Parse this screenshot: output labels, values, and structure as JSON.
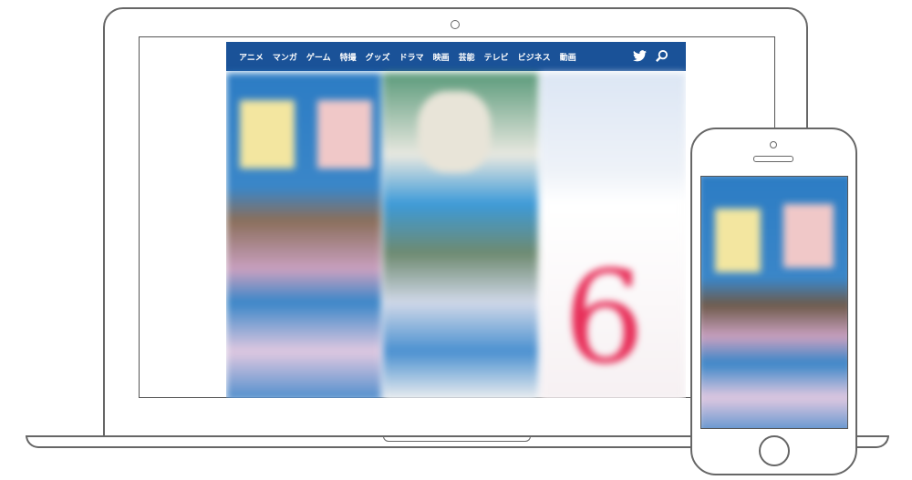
{
  "nav": {
    "items": [
      "アニメ",
      "マンガ",
      "ゲーム",
      "特撮",
      "グッズ",
      "ドラマ",
      "映画",
      "芸能",
      "テレビ",
      "ビジネス",
      "動画"
    ],
    "icons": [
      "twitter-icon",
      "search-icon"
    ]
  },
  "colors": {
    "nav": "#1a5298",
    "accent": "#e8305a"
  },
  "promo": {
    "number": "6"
  }
}
